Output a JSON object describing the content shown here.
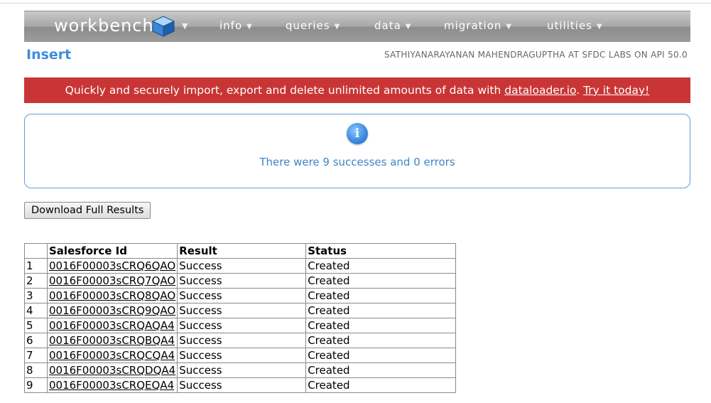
{
  "app": {
    "logo_text": "workbench",
    "nav": [
      {
        "label": "info"
      },
      {
        "label": "queries"
      },
      {
        "label": "data"
      },
      {
        "label": "migration"
      },
      {
        "label": "utilities"
      }
    ]
  },
  "header": {
    "title": "Insert",
    "user_info": "SATHIYANARAYANAN MAHENDRAGUPTHA AT SFDC LABS ON API 50.0"
  },
  "banner": {
    "text": "Quickly and securely import, export and delete unlimited amounts of data with ",
    "link1": "dataloader.io",
    "separator": ". ",
    "link2": "Try it today!"
  },
  "info": {
    "icon": "info-icon",
    "message": "There were 9 successes and 0 errors"
  },
  "actions": {
    "download_label": "Download Full Results"
  },
  "table": {
    "headers": [
      "",
      "Salesforce Id",
      "Result",
      "Status"
    ],
    "rows": [
      {
        "num": "1",
        "id": "0016F00003sCRQ6QAO",
        "result": "Success",
        "status": "Created"
      },
      {
        "num": "2",
        "id": "0016F00003sCRQ7QAO",
        "result": "Success",
        "status": "Created"
      },
      {
        "num": "3",
        "id": "0016F00003sCRQ8QAO",
        "result": "Success",
        "status": "Created"
      },
      {
        "num": "4",
        "id": "0016F00003sCRQ9QAO",
        "result": "Success",
        "status": "Created"
      },
      {
        "num": "5",
        "id": "0016F00003sCRQAQA4",
        "result": "Success",
        "status": "Created"
      },
      {
        "num": "6",
        "id": "0016F00003sCRQBQA4",
        "result": "Success",
        "status": "Created"
      },
      {
        "num": "7",
        "id": "0016F00003sCRQCQA4",
        "result": "Success",
        "status": "Created"
      },
      {
        "num": "8",
        "id": "0016F00003sCRQDQA4",
        "result": "Success",
        "status": "Created"
      },
      {
        "num": "9",
        "id": "0016F00003sCRQEQA4",
        "result": "Success",
        "status": "Created"
      }
    ]
  },
  "colors": {
    "accent": "#3c8ddf",
    "banner": "#c93535",
    "info_border": "#5d9edb",
    "info_text": "#3f84c9"
  }
}
